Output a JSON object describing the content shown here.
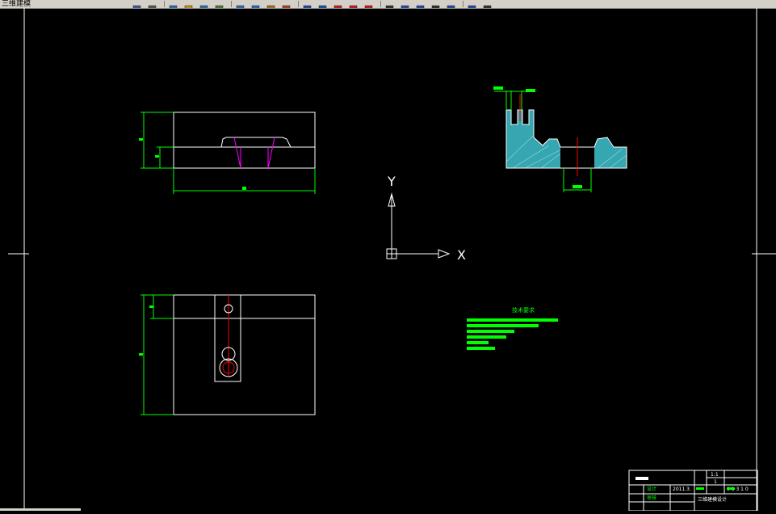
{
  "window": {
    "title": "三维建模"
  },
  "toolbar": {
    "buttons": [
      {
        "icon": "save-icon",
        "color": "#3a5f9e"
      },
      {
        "icon": "print-icon",
        "color": "#555"
      },
      {
        "icon": "new-icon",
        "color": "#2a6fb0"
      },
      {
        "icon": "open-icon",
        "color": "#c0902a"
      },
      {
        "icon": "properties-icon",
        "color": "#2a6fb0"
      },
      {
        "icon": "link-icon",
        "color": "#4a7a3a"
      },
      {
        "icon": "undo-icon",
        "color": "#2a6fb0"
      },
      {
        "icon": "redo-icon",
        "color": "#2a6fb0"
      },
      {
        "icon": "paste-icon",
        "color": "#a07030"
      },
      {
        "icon": "brush-icon",
        "color": "#b04020"
      },
      {
        "icon": "layer-icon",
        "color": "#2050a0"
      },
      {
        "icon": "pan-icon",
        "color": "#2050a0"
      },
      {
        "icon": "zoom-realtime-icon",
        "color": "#c02020"
      },
      {
        "icon": "zoom-window-icon",
        "color": "#c02020"
      },
      {
        "icon": "zoom-previous-icon",
        "color": "#c02020"
      },
      {
        "icon": "text-style-icon",
        "color": "#333"
      },
      {
        "icon": "calculator-icon",
        "color": "#2050a0"
      },
      {
        "icon": "table-icon",
        "color": "#2050a0"
      },
      {
        "icon": "grid-icon",
        "color": "#333"
      },
      {
        "icon": "help-icon",
        "color": "#2050a0"
      },
      {
        "icon": "layers-manager-icon",
        "color": "#2050a0"
      },
      {
        "icon": "more-icon",
        "color": "#333"
      }
    ]
  },
  "drawing": {
    "ucs": {
      "x_label": "X",
      "y_label": "Y"
    },
    "technical_requirements": {
      "title": "技术要求"
    },
    "title_block": {
      "design_label": "设计",
      "check_label": "审核",
      "date": "2011.3.",
      "scale": "1:1",
      "sheet": "1",
      "drawing_no": "0 1 3 1 0",
      "part_name": "三维建模设计"
    }
  },
  "colors": {
    "background": "#000000",
    "lines": "#ffffff",
    "dimension": "#00ff00",
    "hidden": "#ff00ff",
    "center": "#ff0000",
    "hatch": "#00ffff"
  }
}
